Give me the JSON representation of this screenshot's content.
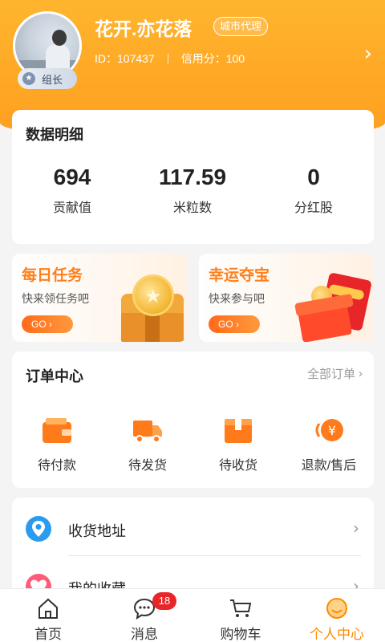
{
  "profile": {
    "username": "花开.亦花落",
    "tag": "城市代理",
    "role": "组长",
    "id_text": "ID：107437",
    "credit_text": "信用分：100"
  },
  "stats": {
    "title": "数据明细",
    "items": [
      {
        "value": "694",
        "label": "贡献值"
      },
      {
        "value": "117.59",
        "label": "米粒数"
      },
      {
        "value": "0",
        "label": "分红股"
      }
    ]
  },
  "promos": {
    "daily": {
      "title": "每日任务",
      "subtitle": "快来领任务吧",
      "button": "GO"
    },
    "lucky": {
      "title": "幸运夺宝",
      "subtitle": "快来参与吧",
      "button": "GO"
    }
  },
  "orders": {
    "title": "订单中心",
    "see_all": "全部订单",
    "items": [
      {
        "label": "待付款",
        "icon": "wallet-icon"
      },
      {
        "label": "待发货",
        "icon": "truck-icon"
      },
      {
        "label": "待收货",
        "icon": "package-icon"
      },
      {
        "label": "退款/售后",
        "icon": "refund-icon"
      }
    ]
  },
  "menu": {
    "items": [
      {
        "label": "收货地址",
        "icon": "location-pin-icon"
      },
      {
        "label": "我的收藏",
        "icon": "heart-icon"
      }
    ]
  },
  "tabbar": {
    "items": [
      {
        "label": "首页",
        "icon": "home-icon"
      },
      {
        "label": "消息",
        "icon": "chat-icon"
      },
      {
        "label": "购物车",
        "icon": "cart-icon"
      },
      {
        "label": "个人中心",
        "icon": "profile-icon"
      }
    ],
    "active_index": 3,
    "message_badge": "18"
  },
  "colors": {
    "accent": "#ff8a00",
    "header_gradient_top": "#ffb52e",
    "header_gradient_bottom": "#ff9e1f",
    "badge_red": "#e8262a"
  }
}
